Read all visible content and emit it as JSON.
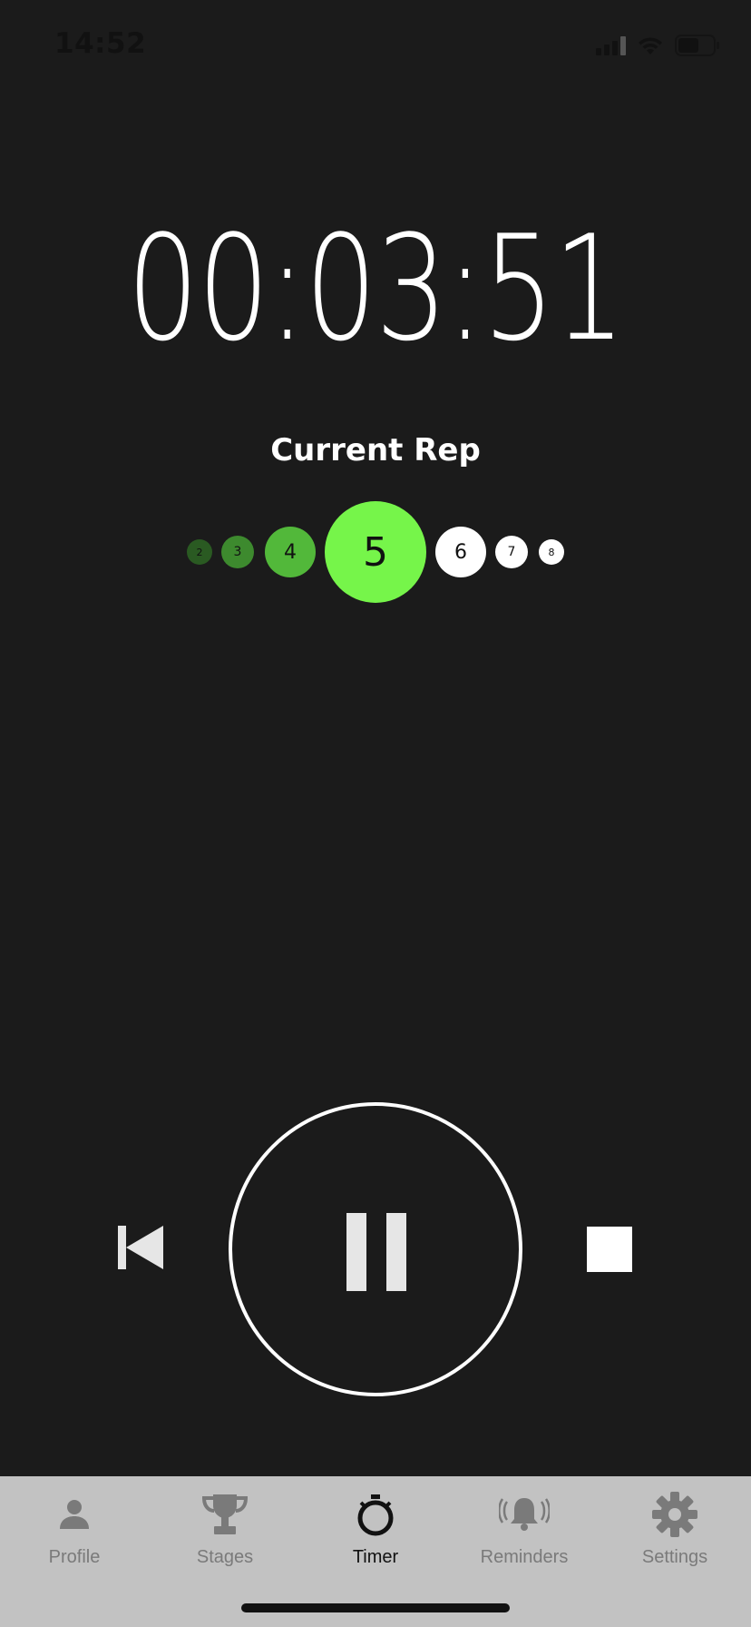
{
  "status_bar": {
    "time": "14:52"
  },
  "timer": {
    "display": "00:03:51"
  },
  "rep_section": {
    "label": "Current Rep",
    "reps": [
      {
        "number": "2",
        "state": "done"
      },
      {
        "number": "3",
        "state": "done"
      },
      {
        "number": "4",
        "state": "done"
      },
      {
        "number": "5",
        "state": "current"
      },
      {
        "number": "6",
        "state": "upcoming"
      },
      {
        "number": "7",
        "state": "upcoming"
      },
      {
        "number": "8",
        "state": "upcoming"
      }
    ],
    "current_rep": 5
  },
  "controls": {
    "previous_icon": "skip-back-icon",
    "pause_icon": "pause-icon",
    "stop_icon": "stop-icon"
  },
  "tabs": [
    {
      "label": "Profile",
      "icon": "person-icon",
      "active": false
    },
    {
      "label": "Stages",
      "icon": "trophy-icon",
      "active": false
    },
    {
      "label": "Timer",
      "icon": "stopwatch-icon",
      "active": true
    },
    {
      "label": "Reminders",
      "icon": "bell-icon",
      "active": false
    },
    {
      "label": "Settings",
      "icon": "gear-icon",
      "active": false
    }
  ],
  "colors": {
    "background": "#1b1b1b",
    "accent_current": "#76f54a",
    "rep_done_1": "#2a5a22",
    "rep_done_2": "#3d8a2e",
    "rep_done_3": "#52b83a",
    "upcoming": "#ffffff",
    "tab_bar": "#c2c2c2"
  }
}
